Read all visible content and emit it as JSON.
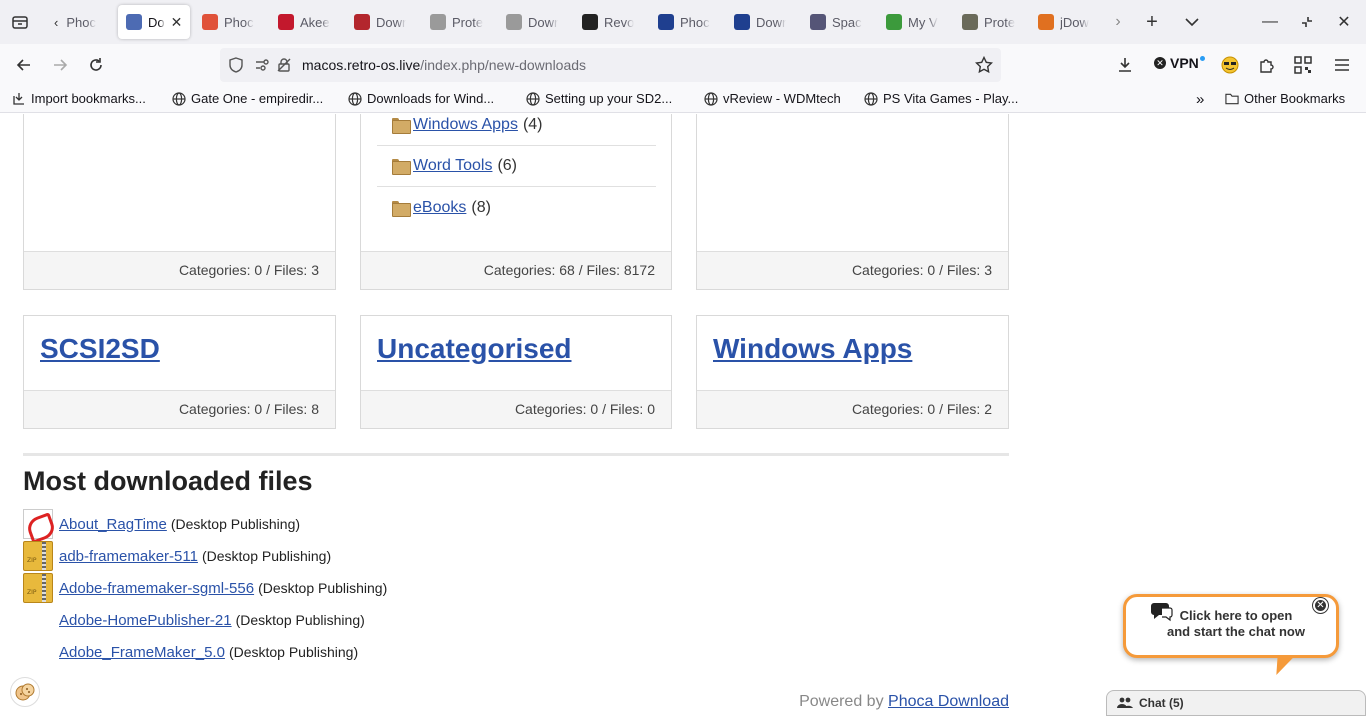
{
  "browser": {
    "tabs": [
      {
        "label": "Phoc",
        "color": "#ffffff",
        "icon": "chevron-left-icon"
      },
      {
        "label": "Do",
        "color": "#4d6bb3",
        "active": true
      },
      {
        "label": "Phoc",
        "color": "#e0523a"
      },
      {
        "label": "Akee",
        "color": "#c3182d"
      },
      {
        "label": "Dowr",
        "color": "#b3262d"
      },
      {
        "label": "Prote",
        "color": "#9a9a9a"
      },
      {
        "label": "Dowr",
        "color": "#9a9a9a"
      },
      {
        "label": "Revo",
        "color": "#222222"
      },
      {
        "label": "Phoc",
        "color": "#1f3f8f"
      },
      {
        "label": "Dowr",
        "color": "#1f3f8f"
      },
      {
        "label": "Spac",
        "color": "#555577"
      },
      {
        "label": "My V",
        "color": "#3c9a3c"
      },
      {
        "label": "Prote",
        "color": "#6a6a5a"
      },
      {
        "label": "jDow",
        "color": "#e07020"
      }
    ],
    "url_host": "macos.retro-os.live",
    "url_path": "/index.php/new-downloads",
    "vpn_label": "VPN",
    "bookmarks": [
      {
        "label": "Import bookmarks...",
        "icon": "import-icon"
      },
      {
        "label": "Gate One - empiredir...",
        "icon": "globe-icon"
      },
      {
        "label": "Downloads for Wind...",
        "icon": "globe-icon"
      },
      {
        "label": "Setting up your SD2...",
        "icon": "globe-icon"
      },
      {
        "label": "vReview - WDMtech",
        "icon": "globe-icon"
      },
      {
        "label": "PS Vita Games - Play...",
        "icon": "globe-icon"
      }
    ],
    "other_bookmarks": "Other Bookmarks"
  },
  "top_cards": [
    {
      "footer": "Categories: 0 / Files: 3"
    },
    {
      "footer": "Categories: 68 / Files: 8172",
      "subcategories": [
        {
          "name": "Windows Apps",
          "count": "(4)"
        },
        {
          "name": "Word Tools",
          "count": "(6)"
        },
        {
          "name": "eBooks",
          "count": "(8)"
        }
      ]
    },
    {
      "footer": "Categories: 0 / Files: 3"
    }
  ],
  "bottom_cards": [
    {
      "title": "SCSI2SD",
      "footer": "Categories: 0 / Files: 8"
    },
    {
      "title": "Uncategorised",
      "footer": "Categories: 0 / Files: 0"
    },
    {
      "title": "Windows Apps",
      "footer": "Categories: 0 / Files: 2"
    }
  ],
  "most_downloaded": {
    "title": "Most downloaded files",
    "files": [
      {
        "name": "About_RagTime",
        "category": "(Desktop Publishing)",
        "icon": "pdf-icon"
      },
      {
        "name": "adb-framemaker-511",
        "category": "(Desktop Publishing)",
        "icon": "zip-icon"
      },
      {
        "name": "Adobe-framemaker-sgml-556",
        "category": "(Desktop Publishing)",
        "icon": "zip-icon"
      },
      {
        "name": "Adobe-HomePublisher-21",
        "category": "(Desktop Publishing)",
        "icon": ""
      },
      {
        "name": "Adobe_FrameMaker_5.0",
        "category": "(Desktop Publishing)",
        "icon": ""
      }
    ]
  },
  "footer": {
    "powered_by": "Powered by",
    "powered_link": "Phoca Download"
  },
  "chat": {
    "prompt_line1": "Click here to open",
    "prompt_line2": "and start the chat now",
    "bar_label": "Chat (5)",
    "accent": "#f59a3a"
  }
}
